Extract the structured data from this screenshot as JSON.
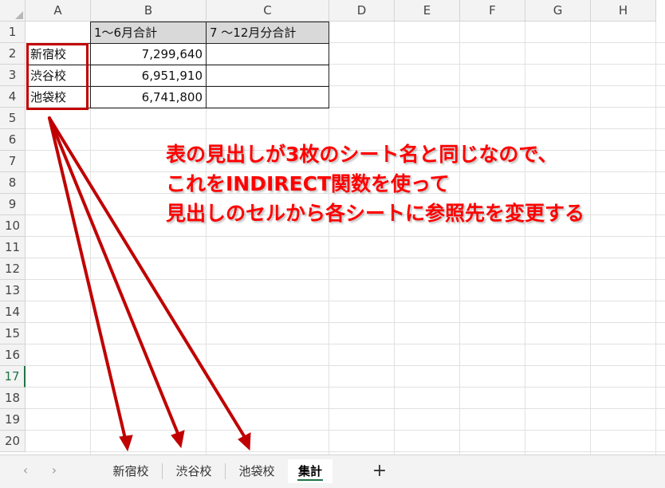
{
  "columns": [
    "A",
    "B",
    "C",
    "D",
    "E",
    "F",
    "G",
    "H"
  ],
  "rows": [
    "1",
    "2",
    "3",
    "4",
    "5",
    "6",
    "7",
    "8",
    "9",
    "10",
    "11",
    "12",
    "13",
    "14",
    "15",
    "16",
    "17",
    "18",
    "19",
    "20"
  ],
  "active_row": "17",
  "table": {
    "header_b": "1～6月合計",
    "header_c": "7 ～12月分合計",
    "rows": [
      {
        "name": "新宿校",
        "total": "7,299,640",
        "second": ""
      },
      {
        "name": "渋谷校",
        "total": "6,951,910",
        "second": ""
      },
      {
        "name": "池袋校",
        "total": "6,741,800",
        "second": ""
      }
    ]
  },
  "annotation": {
    "line1": "表の見出しが3枚のシート名と同じなので、",
    "line2": "これをINDIRECT関数を使って",
    "line3": "見出しのセルから各シートに参照先を変更する",
    "color": "#ff0000"
  },
  "highlight_color": "#c00000",
  "sheet_tabs": [
    {
      "label": "新宿校",
      "active": false
    },
    {
      "label": "渋谷校",
      "active": false
    },
    {
      "label": "池袋校",
      "active": false
    },
    {
      "label": "集計",
      "active": true
    }
  ],
  "nav": {
    "prev": "‹",
    "next": "›",
    "add": "+"
  },
  "accent_color": "#217346"
}
